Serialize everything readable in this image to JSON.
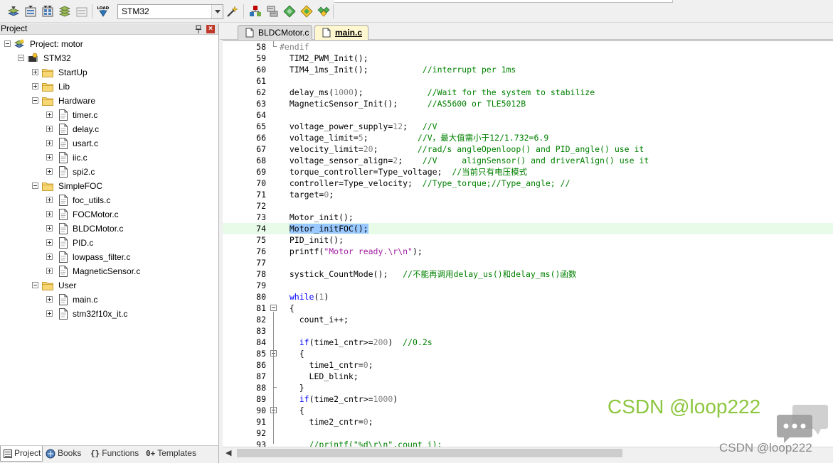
{
  "toolbar": {
    "target": "STM32"
  },
  "project_panel": {
    "title": "Project",
    "tree": [
      {
        "label": "Project: motor",
        "level": 0,
        "kind": "project",
        "exp": "minus"
      },
      {
        "label": "STM32",
        "level": 1,
        "kind": "target",
        "exp": "minus"
      },
      {
        "label": "StartUp",
        "level": 2,
        "kind": "folder",
        "exp": "plus"
      },
      {
        "label": "Lib",
        "level": 2,
        "kind": "folder",
        "exp": "plus"
      },
      {
        "label": "Hardware",
        "level": 2,
        "kind": "folder",
        "exp": "minus"
      },
      {
        "label": "timer.c",
        "level": 3,
        "kind": "file",
        "exp": "plus"
      },
      {
        "label": "delay.c",
        "level": 3,
        "kind": "file",
        "exp": "plus"
      },
      {
        "label": "usart.c",
        "level": 3,
        "kind": "file",
        "exp": "plus"
      },
      {
        "label": "iic.c",
        "level": 3,
        "kind": "file",
        "exp": "plus"
      },
      {
        "label": "spi2.c",
        "level": 3,
        "kind": "file",
        "exp": "plus"
      },
      {
        "label": "SimpleFOC",
        "level": 2,
        "kind": "folder",
        "exp": "minus"
      },
      {
        "label": "foc_utils.c",
        "level": 3,
        "kind": "file",
        "exp": "plus"
      },
      {
        "label": "FOCMotor.c",
        "level": 3,
        "kind": "file",
        "exp": "plus"
      },
      {
        "label": "BLDCMotor.c",
        "level": 3,
        "kind": "file",
        "exp": "plus"
      },
      {
        "label": "PID.c",
        "level": 3,
        "kind": "file",
        "exp": "plus"
      },
      {
        "label": "lowpass_filter.c",
        "level": 3,
        "kind": "file",
        "exp": "plus"
      },
      {
        "label": "MagneticSensor.c",
        "level": 3,
        "kind": "file",
        "exp": "plus"
      },
      {
        "label": "User",
        "level": 2,
        "kind": "folder",
        "exp": "minus"
      },
      {
        "label": "main.c",
        "level": 3,
        "kind": "file",
        "exp": "plus"
      },
      {
        "label": "stm32f10x_it.c",
        "level": 3,
        "kind": "file",
        "exp": "plus"
      }
    ],
    "tabs": {
      "project": "Project",
      "books": "Books",
      "functions": "Functions",
      "templates": "Templates"
    }
  },
  "editor": {
    "tabs": {
      "bldc": "BLDCMotor.c",
      "main": "main.c"
    },
    "current_line": 74,
    "lines": [
      {
        "n": "58",
        "fold": "end",
        "parts": [
          {
            "c": "pp",
            "t": "#endif"
          }
        ]
      },
      {
        "n": "59",
        "parts": [
          {
            "t": "  TIM2_PWM_Init();"
          }
        ]
      },
      {
        "n": "60",
        "parts": [
          {
            "t": "  TIM4_1ms_Init();           "
          },
          {
            "c": "cm",
            "t": "//interrupt per 1ms"
          }
        ]
      },
      {
        "n": "61",
        "parts": []
      },
      {
        "n": "62",
        "parts": [
          {
            "t": "  delay_ms("
          },
          {
            "c": "nm",
            "t": "1000"
          },
          {
            "t": ");             "
          },
          {
            "c": "cm",
            "t": "//Wait for the system to stabilize"
          }
        ]
      },
      {
        "n": "63",
        "parts": [
          {
            "t": "  MagneticSensor_Init();      "
          },
          {
            "c": "cm",
            "t": "//AS5600 or TLE5012B"
          }
        ]
      },
      {
        "n": "64",
        "parts": []
      },
      {
        "n": "65",
        "parts": [
          {
            "t": "  voltage_power_supply="
          },
          {
            "c": "nm",
            "t": "12"
          },
          {
            "t": ";   "
          },
          {
            "c": "cm",
            "t": "//V"
          }
        ]
      },
      {
        "n": "66",
        "parts": [
          {
            "t": "  voltage_limit="
          },
          {
            "c": "nm",
            "t": "5"
          },
          {
            "t": ";          "
          },
          {
            "c": "cm",
            "t": "//V，最大值需小于12/1.732=6.9"
          }
        ]
      },
      {
        "n": "67",
        "parts": [
          {
            "t": "  velocity_limit="
          },
          {
            "c": "nm",
            "t": "20"
          },
          {
            "t": ";        "
          },
          {
            "c": "cm",
            "t": "//rad/s angleOpenloop() and PID_angle() use it"
          }
        ]
      },
      {
        "n": "68",
        "parts": [
          {
            "t": "  voltage_sensor_align="
          },
          {
            "c": "nm",
            "t": "2"
          },
          {
            "t": ";    "
          },
          {
            "c": "cm",
            "t": "//V     alignSensor() and driverAlign() use it"
          }
        ]
      },
      {
        "n": "69",
        "parts": [
          {
            "t": "  torque_controller=Type_voltage;  "
          },
          {
            "c": "cm",
            "t": "//当前只有电压模式"
          }
        ]
      },
      {
        "n": "70",
        "parts": [
          {
            "t": "  controller=Type_velocity;  "
          },
          {
            "c": "cm",
            "t": "//Type_torque;//Type_angle; //"
          }
        ]
      },
      {
        "n": "71",
        "parts": [
          {
            "t": "  target="
          },
          {
            "c": "nm",
            "t": "0"
          },
          {
            "t": ";"
          }
        ]
      },
      {
        "n": "72",
        "parts": []
      },
      {
        "n": "73",
        "parts": [
          {
            "t": "  Motor_init();"
          }
        ]
      },
      {
        "n": "74",
        "parts": [
          {
            "t": "  "
          },
          {
            "c": "sel",
            "t": "Motor_initFOC();"
          }
        ]
      },
      {
        "n": "75",
        "parts": [
          {
            "t": "  PID_init();"
          }
        ]
      },
      {
        "n": "76",
        "parts": [
          {
            "t": "  printf("
          },
          {
            "c": "st",
            "t": "\"Motor ready.\\r\\n\""
          },
          {
            "t": ");"
          }
        ]
      },
      {
        "n": "77",
        "parts": []
      },
      {
        "n": "78",
        "parts": [
          {
            "t": "  systick_CountMode();   "
          },
          {
            "c": "cm",
            "t": "//不能再调用delay_us()和delay_ms()函数"
          }
        ]
      },
      {
        "n": "79",
        "parts": []
      },
      {
        "n": "80",
        "parts": [
          {
            "t": "  "
          },
          {
            "c": "kw",
            "t": "while"
          },
          {
            "t": "("
          },
          {
            "c": "nm",
            "t": "1"
          },
          {
            "t": ")"
          }
        ]
      },
      {
        "n": "81",
        "fold": "box",
        "parts": [
          {
            "t": "  {"
          }
        ]
      },
      {
        "n": "82",
        "parts": [
          {
            "t": "    count_i++;"
          }
        ]
      },
      {
        "n": "83",
        "parts": []
      },
      {
        "n": "84",
        "parts": [
          {
            "t": "    "
          },
          {
            "c": "kw",
            "t": "if"
          },
          {
            "t": "(time1_cntr>="
          },
          {
            "c": "nm",
            "t": "200"
          },
          {
            "t": ")  "
          },
          {
            "c": "cm",
            "t": "//0.2s"
          }
        ]
      },
      {
        "n": "85",
        "fold": "box",
        "parts": [
          {
            "t": "    {"
          }
        ]
      },
      {
        "n": "86",
        "parts": [
          {
            "t": "      time1_cntr="
          },
          {
            "c": "nm",
            "t": "0"
          },
          {
            "t": ";"
          }
        ]
      },
      {
        "n": "87",
        "parts": [
          {
            "t": "      LED_blink;"
          }
        ]
      },
      {
        "n": "88",
        "fold": "end",
        "parts": [
          {
            "t": "    }"
          }
        ]
      },
      {
        "n": "89",
        "parts": [
          {
            "t": "    "
          },
          {
            "c": "kw",
            "t": "if"
          },
          {
            "t": "(time2_cntr>="
          },
          {
            "c": "nm",
            "t": "1000"
          },
          {
            "t": ")"
          }
        ]
      },
      {
        "n": "90",
        "fold": "box",
        "parts": [
          {
            "t": "    {"
          }
        ]
      },
      {
        "n": "91",
        "parts": [
          {
            "t": "      time2_cntr="
          },
          {
            "c": "nm",
            "t": "0"
          },
          {
            "t": ";"
          }
        ]
      },
      {
        "n": "92",
        "parts": []
      },
      {
        "n": "93",
        "parts": [
          {
            "t": "      "
          },
          {
            "c": "cm",
            "t": "//printf(\"%d\\r\\n\",count_i);"
          }
        ]
      }
    ]
  },
  "watermark": {
    "main": "CSDN @loop222",
    "footer": "CSDN @loop222"
  },
  "colors": {
    "comment": "#008000",
    "keyword": "#0000ff",
    "number": "#808080",
    "string": "#a020a0",
    "selection": "#99c9ff",
    "current_line": "#e8fbe8",
    "watermark": "#8dc63f"
  }
}
